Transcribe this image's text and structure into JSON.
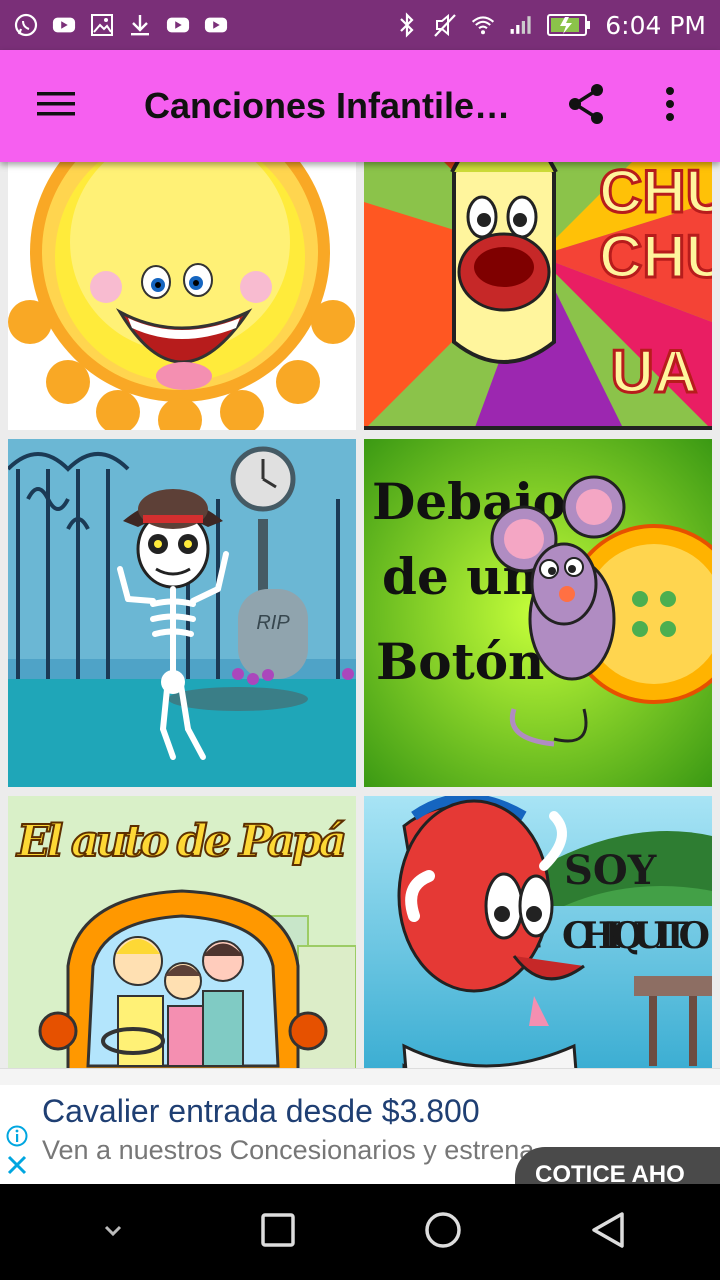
{
  "status": {
    "left_icons": [
      "whatsapp-icon",
      "youtube-icon",
      "gallery-icon",
      "download-icon",
      "youtube-icon",
      "youtube-icon"
    ],
    "right_icons": [
      "bluetooth-icon",
      "mute-icon",
      "wifi-icon",
      "signal-icon",
      "battery-icon"
    ],
    "time": "6:04 PM"
  },
  "appbar": {
    "title": "Canciones Infantile…",
    "menu_icon": "hamburger-icon",
    "share_icon": "share-icon",
    "more_icon": "more-vert-icon",
    "background": "#f65ff0"
  },
  "tiles": [
    {
      "name": "sun",
      "text": ""
    },
    {
      "name": "chu-chu-ua",
      "lines": [
        "CHU",
        "CHU",
        "UA"
      ]
    },
    {
      "name": "skeleton",
      "tomb_text": "RIP"
    },
    {
      "name": "debajo-de-un-boton",
      "lines": [
        "Debajo",
        "de un",
        "Botón"
      ]
    },
    {
      "name": "el-auto-de-papa",
      "text": "El auto de Papá"
    },
    {
      "name": "soy-chiquito",
      "lines": [
        "SOY",
        "CHIQUITO"
      ]
    }
  ],
  "ad": {
    "title": "Cavalier entrada desde $3.800",
    "description": "Ven a nuestros Concesionarios y estrena",
    "cta": "COTICE AHO",
    "info_icon": "info-icon",
    "close_icon": "close-icon"
  },
  "nav": {
    "icons": [
      "chevron-down-icon",
      "recents-icon",
      "home-icon",
      "back-icon"
    ]
  }
}
